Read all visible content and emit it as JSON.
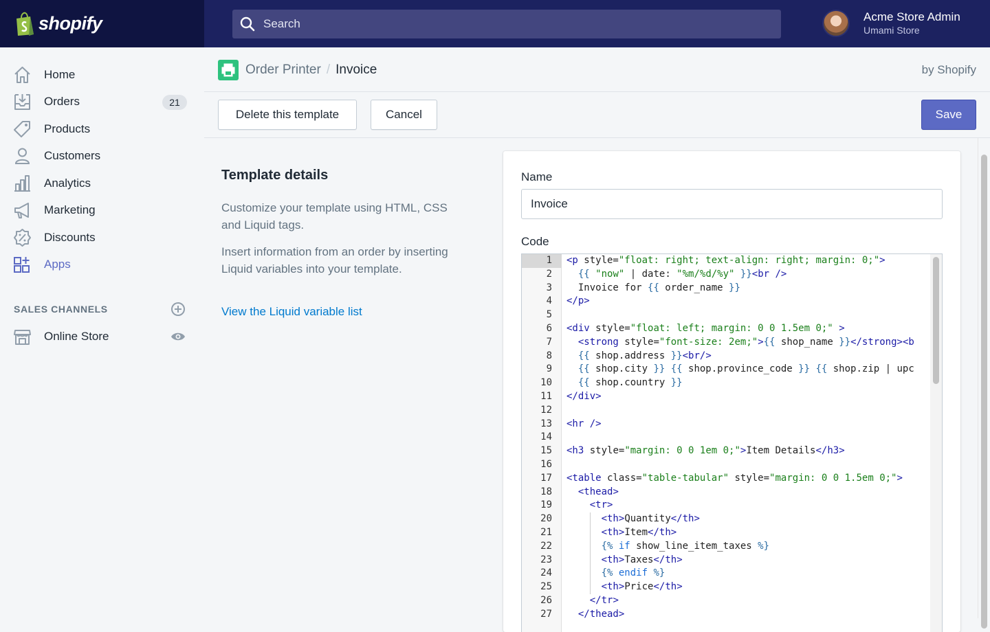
{
  "topbar": {
    "logo_text": "shopify",
    "search_placeholder": "Search",
    "user_name": "Acme Store Admin",
    "store_name": "Umami Store"
  },
  "sidebar": {
    "items": [
      {
        "label": "Home",
        "icon": "home-icon"
      },
      {
        "label": "Orders",
        "icon": "orders-icon",
        "badge": "21"
      },
      {
        "label": "Products",
        "icon": "tag-icon"
      },
      {
        "label": "Customers",
        "icon": "person-icon"
      },
      {
        "label": "Analytics",
        "icon": "bar-chart-icon"
      },
      {
        "label": "Marketing",
        "icon": "megaphone-icon"
      },
      {
        "label": "Discounts",
        "icon": "discount-icon"
      },
      {
        "label": "Apps",
        "icon": "apps-icon",
        "active": true
      }
    ],
    "sales_channels_title": "SALES CHANNELS",
    "channels": [
      {
        "label": "Online Store",
        "icon": "store-icon"
      }
    ]
  },
  "header": {
    "app_name": "Order Printer",
    "separator": "/",
    "current": "Invoice",
    "by": "by Shopify"
  },
  "actions": {
    "delete_label": "Delete this template",
    "cancel_label": "Cancel",
    "save_label": "Save"
  },
  "details": {
    "title": "Template details",
    "paragraph1": "Customize your template using HTML, CSS and Liquid tags.",
    "paragraph2": "Insert information from an order by inserting Liquid variables into your template.",
    "link": "View the Liquid variable list"
  },
  "form": {
    "name_label": "Name",
    "name_value": "Invoice",
    "code_label": "Code"
  },
  "colors": {
    "topbar": "#1c2260",
    "logo_bg": "#0f1441",
    "accent": "#5c6ac4",
    "link": "#007ace"
  },
  "code_lines": [
    "<p style=\"float: right; text-align: right; margin: 0;\">",
    "  {{ \"now\" | date: \"%m/%d/%y\" }}<br />",
    "  Invoice for {{ order_name }}",
    "</p>",
    "",
    "<div style=\"float: left; margin: 0 0 1.5em 0;\" >",
    "  <strong style=\"font-size: 2em;\">{{ shop_name }}</strong><b",
    "  {{ shop.address }}<br/>",
    "  {{ shop.city }} {{ shop.province_code }} {{ shop.zip | upc",
    "  {{ shop.country }}",
    "</div>",
    "",
    "<hr />",
    "",
    "<h3 style=\"margin: 0 0 1em 0;\">Item Details</h3>",
    "",
    "<table class=\"table-tabular\" style=\"margin: 0 0 1.5em 0;\">",
    "  <thead>",
    "    <tr>",
    "      <th>Quantity</th>",
    "      <th>Item</th>",
    "      {% if show_line_item_taxes %}",
    "      <th>Taxes</th>",
    "      {% endif %}",
    "      <th>Price</th>",
    "    </tr>",
    "  </thead>"
  ]
}
